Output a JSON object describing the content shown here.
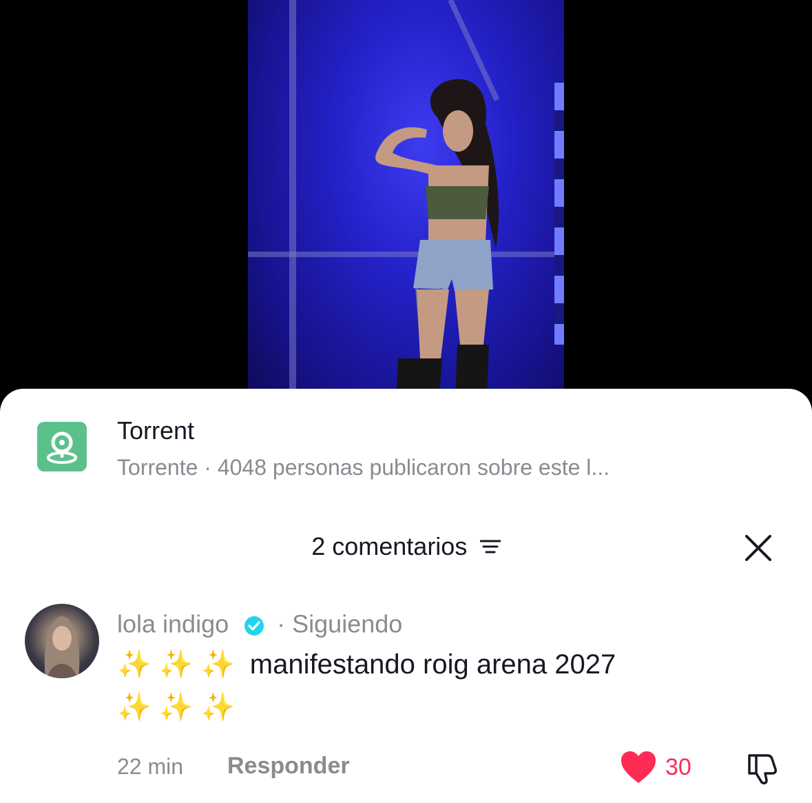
{
  "location": {
    "name": "Torrent",
    "subtitle": "Torrente · 4048 personas publicaron sobre este l..."
  },
  "comments_panel": {
    "count_label": "2 comentarios",
    "comment": {
      "username": "lola indigo",
      "follow_status": "· Siguiendo",
      "line1_sparkles": "✨ ✨ ✨",
      "text": "manifestando roig arena 2027",
      "line2_sparkles": "✨ ✨ ✨",
      "time": "22 min",
      "reply_label": "Responder",
      "likes": "30"
    }
  },
  "icons": [
    "location-pin-icon",
    "filter-icon",
    "close-icon",
    "verified-badge-icon",
    "heart-icon",
    "dislike-icon"
  ],
  "colors": {
    "location_icon_bg": "#5cc08d",
    "like_red": "#fe2c55",
    "verified_blue": "#20d5ec",
    "stage_blue": "#2421c9"
  }
}
